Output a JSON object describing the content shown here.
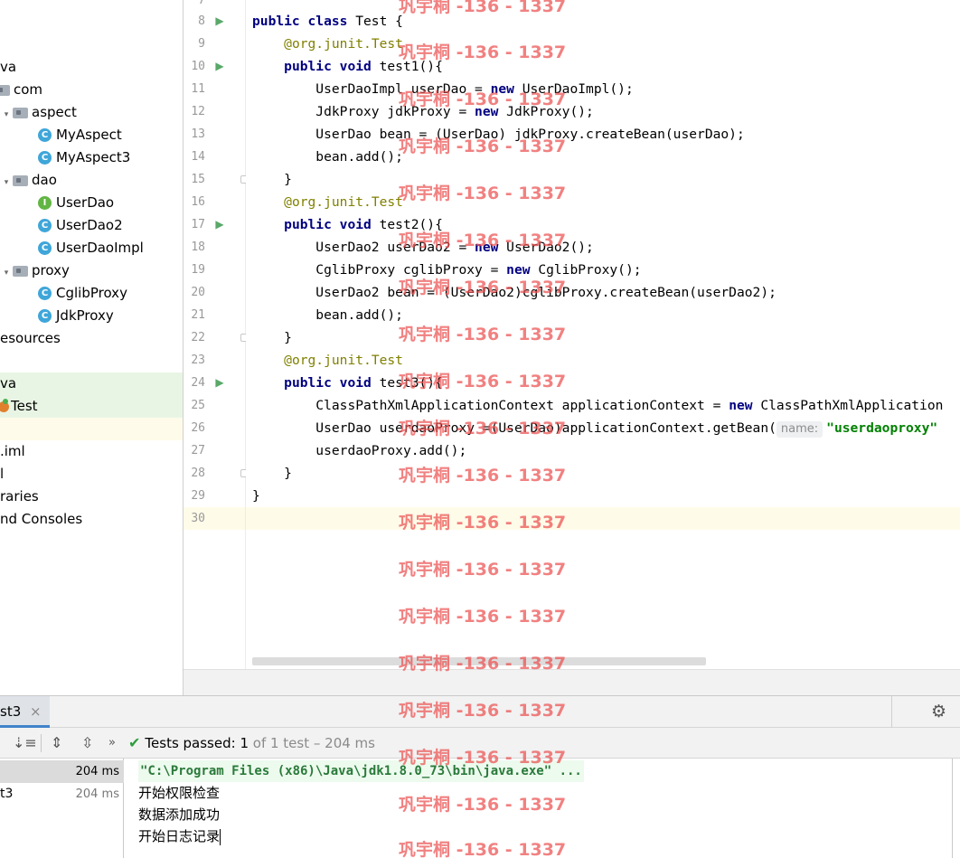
{
  "tree": {
    "items": [
      {
        "label": "va",
        "icon": "none"
      },
      {
        "label": "com",
        "icon": "package-icon"
      },
      {
        "label": "aspect",
        "icon": "package-icon"
      },
      {
        "label": "MyAspect",
        "icon": "class-icon"
      },
      {
        "label": "MyAspect3",
        "icon": "class-icon"
      },
      {
        "label": "dao",
        "icon": "package-icon"
      },
      {
        "label": "UserDao",
        "icon": "interface-icon"
      },
      {
        "label": "UserDao2",
        "icon": "class-icon"
      },
      {
        "label": "UserDaoImpl",
        "icon": "class-icon"
      },
      {
        "label": "proxy",
        "icon": "package-icon"
      },
      {
        "label": "CglibProxy",
        "icon": "class-icon"
      },
      {
        "label": "JdkProxy",
        "icon": "class-icon"
      },
      {
        "label": "esources",
        "icon": "none"
      },
      {
        "label": "va",
        "icon": "none"
      },
      {
        "label": "Test",
        "icon": "test-class-icon"
      },
      {
        "label": ".iml",
        "icon": "none"
      },
      {
        "label": "l",
        "icon": "none"
      },
      {
        "label": "raries",
        "icon": "none"
      },
      {
        "label": "nd Consoles",
        "icon": "none"
      }
    ],
    "icon_letters": {
      "class": "C",
      "interface": "I"
    }
  },
  "editor": {
    "line_numbers": [
      "7",
      "8",
      "9",
      "10",
      "11",
      "12",
      "13",
      "14",
      "15",
      "16",
      "17",
      "18",
      "19",
      "20",
      "21",
      "22",
      "23",
      "24",
      "25",
      "26",
      "27",
      "28",
      "29",
      "30"
    ],
    "code": {
      "l8_kw": "public class ",
      "l8_rest": "Test {",
      "l9_an": "@org.junit.",
      "l9_test": "Test",
      "l10_kw": "public void ",
      "l10_rest": "test1(){",
      "l11_a": "UserDaoImpl userDao = ",
      "l11_kw": "new",
      "l11_b": " UserDaoImpl();",
      "l12_a": "JdkProxy jdkProxy = ",
      "l12_kw": "new",
      "l12_b": " JdkProxy();",
      "l13": "UserDao bean = (UserDao) jdkProxy.createBean(userDao);",
      "l14": "bean.add();",
      "l15": "}",
      "l16_an": "@org.junit.",
      "l16_test": "Test",
      "l17_kw": "public void ",
      "l17_rest": "test2(){",
      "l18_a": "UserDao2 userDao2 = ",
      "l18_kw": "new",
      "l18_b": " UserDao2();",
      "l19_a": "CglibProxy cglibProxy = ",
      "l19_kw": "new",
      "l19_b": " CglibProxy();",
      "l20": "UserDao2 bean = (UserDao2)cglibProxy.createBean(userDao2);",
      "l21": "bean.add();",
      "l22": "}",
      "l23_an": "@org.junit.",
      "l23_test": "Test",
      "l24_kw": "public void ",
      "l24_rest": "test3(){",
      "l25_a": "ClassPathXmlApplicationContext applicationContext = ",
      "l25_kw": "new",
      "l25_b": " ClassPathXmlApplication",
      "l26_a": "UserDao userdaoProxy =(UserDao)applicationContext.getBean(",
      "l26_hint": "name:",
      "l26_str": "\"userdaoproxy\"",
      "l27": "userdaoProxy.add();",
      "l28": "}",
      "l29": "}"
    }
  },
  "run": {
    "tab_label": "st3",
    "tab_close": "×",
    "status_prefix": "Tests passed: ",
    "status_count": "1",
    "status_rest": " of 1 test – 204 ms",
    "tests": [
      {
        "name": "",
        "time": "204 ms"
      },
      {
        "name": "t3",
        "time": "204 ms"
      }
    ],
    "console": [
      "\"C:\\Program Files (x86)\\Java\\jdk1.8.0_73\\bin\\java.exe\" ...",
      "开始权限检查",
      "数据添加成功",
      "开始日志记录"
    ]
  },
  "watermark": "巩宇桐 -136 - 1337"
}
